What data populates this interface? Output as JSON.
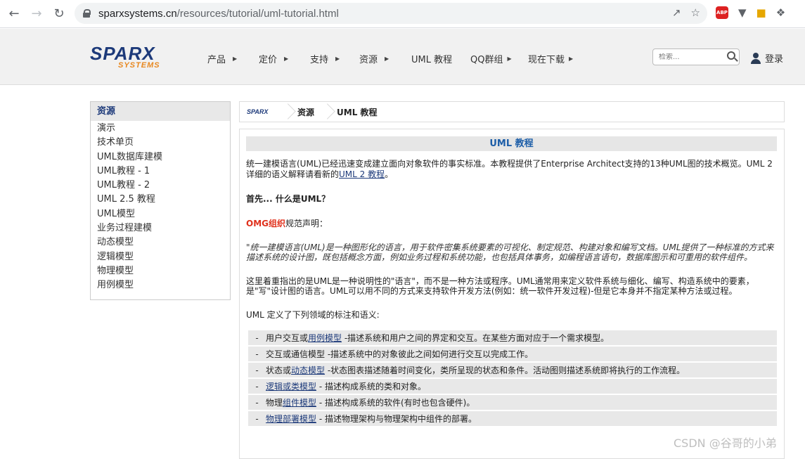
{
  "browser": {
    "url_host": "sparxsystems.cn",
    "url_path": "/resources/tutorial/uml-tutorial.html"
  },
  "header": {
    "logo_main": "SPARX",
    "logo_sub": "SYSTEMS",
    "nav": [
      {
        "label": "产品"
      },
      {
        "label": "定价"
      },
      {
        "label": "支持"
      },
      {
        "label": "资源"
      },
      {
        "label": "UML 教程"
      },
      {
        "label": "QQ群组"
      },
      {
        "label": "现在下载"
      }
    ],
    "search_placeholder": "检索...",
    "login_label": "登录"
  },
  "sidebar": {
    "heading": "资源",
    "items": [
      "演示",
      "技术单页",
      "UML数据库建模",
      "UML教程 - 1",
      "UML教程 - 2",
      "UML 2.5 教程",
      "UML模型",
      "业务过程建模",
      "动态模型",
      "逻辑模型",
      "物理模型",
      "用例模型"
    ]
  },
  "breadcrumb": {
    "logo": "SPARX",
    "items": [
      "资源",
      "UML 教程"
    ]
  },
  "content": {
    "title": "UML 教程",
    "intro_text": "统一建模语言(UML)已经迅速变成建立面向对象软件的事实标准。本教程提供了Enterprise Architect支持的13种UML图的技术概览。UML 2 详细的语义解释请看新的",
    "intro_link": "UML 2 教程",
    "intro_end": "。",
    "question": "首先... 什么是UML？",
    "omg_link": "OMG组织",
    "omg_rest": "规范声明：",
    "quote": "\"统一建模语言(UML)是一种图形化的语言，用于软件密集系统要素的可视化、制定规范、构建对象和编写文档。UML提供了一种标准的方式来描述系统的设计图，既包括概念方面，例如业务过程和系统功能，也包括具体事务，如编程语言语句，数据库图示和可重用的软件组件。",
    "explanation": "这里着重指出的是UML是一种说明性的\"语言\"，而不是一种方法或程序。UML通常用来定义软件系统与细化、编写、构造系统中的要素，是\"写\"设计图的语言。UML可以用不同的方式来支持软件开发方法(例如：统一软件开发过程)-但是它本身并不指定某种方法或过程。",
    "uml_defines": "UML 定义了下列领域的标注和语义:",
    "list": [
      {
        "pre": "用户交互或",
        "link": "用例模型",
        "post": " -描述系统和用户之间的界定和交互。在某些方面对应于一个需求模型。"
      },
      {
        "pre": "交互或通信模型 -描述系统中的对象彼此之间如何进行交互以完成工作。",
        "link": "",
        "post": ""
      },
      {
        "pre": "状态或",
        "link": "动态模型",
        "post": " -状态图表描述随着时间变化，类所呈现的状态和条件。活动图则描述系统即将执行的工作流程。"
      },
      {
        "pre": "",
        "link": "逻辑或类模型",
        "post": " - 描述构成系统的类和对象。"
      },
      {
        "pre": "物理",
        "link": "组件模型",
        "post": " - 描述构成系统的软件(有时也包含硬件)。"
      },
      {
        "pre": "",
        "link": "物理部署模型",
        "post": " - 描述物理架构与物理架构中组件的部署。"
      }
    ],
    "dash": "-"
  },
  "watermark": "CSDN @谷哥的小弟"
}
